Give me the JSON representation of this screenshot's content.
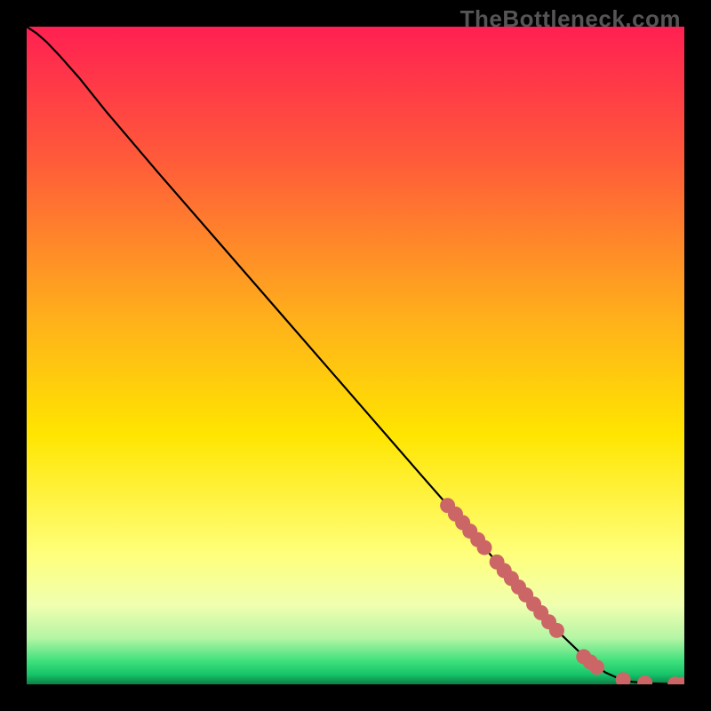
{
  "watermark": "TheBottleneck.com",
  "chart_data": {
    "type": "line",
    "title": "",
    "xlabel": "",
    "ylabel": "",
    "xlim": [
      0,
      100
    ],
    "ylim": [
      0,
      100
    ],
    "gradient_stops": [
      {
        "offset": 0.0,
        "color": "#FF2052"
      },
      {
        "offset": 0.2,
        "color": "#FF5A3A"
      },
      {
        "offset": 0.45,
        "color": "#FFB21A"
      },
      {
        "offset": 0.62,
        "color": "#FFE500"
      },
      {
        "offset": 0.8,
        "color": "#FFFF7A"
      },
      {
        "offset": 0.88,
        "color": "#F0FFB0"
      },
      {
        "offset": 0.93,
        "color": "#B4F5A4"
      },
      {
        "offset": 0.965,
        "color": "#3EE07C"
      },
      {
        "offset": 0.985,
        "color": "#17C46A"
      },
      {
        "offset": 1.0,
        "color": "#0B7F45"
      }
    ],
    "curve": [
      {
        "x": 0,
        "y": 100
      },
      {
        "x": 1.5,
        "y": 99.0
      },
      {
        "x": 3.0,
        "y": 97.7
      },
      {
        "x": 5.0,
        "y": 95.6
      },
      {
        "x": 8.0,
        "y": 92.2
      },
      {
        "x": 12.0,
        "y": 87.2
      },
      {
        "x": 20.0,
        "y": 77.8
      },
      {
        "x": 30.0,
        "y": 66.3
      },
      {
        "x": 40.0,
        "y": 54.8
      },
      {
        "x": 50.0,
        "y": 43.3
      },
      {
        "x": 60.0,
        "y": 31.8
      },
      {
        "x": 65.0,
        "y": 26.1
      },
      {
        "x": 70.0,
        "y": 20.3
      },
      {
        "x": 75.0,
        "y": 14.6
      },
      {
        "x": 80.0,
        "y": 8.8
      },
      {
        "x": 85.0,
        "y": 4.0
      },
      {
        "x": 88.0,
        "y": 1.8
      },
      {
        "x": 90.0,
        "y": 0.9
      },
      {
        "x": 92.0,
        "y": 0.4
      },
      {
        "x": 95.0,
        "y": 0.15
      },
      {
        "x": 98.0,
        "y": 0.05
      },
      {
        "x": 100.0,
        "y": 0.0
      }
    ],
    "markers": [
      {
        "x": 64.0,
        "y": 27.2
      },
      {
        "x": 65.2,
        "y": 25.9
      },
      {
        "x": 66.3,
        "y": 24.6
      },
      {
        "x": 67.4,
        "y": 23.3
      },
      {
        "x": 68.6,
        "y": 22.0
      },
      {
        "x": 69.6,
        "y": 20.8
      },
      {
        "x": 71.5,
        "y": 18.6
      },
      {
        "x": 72.6,
        "y": 17.3
      },
      {
        "x": 73.7,
        "y": 16.1
      },
      {
        "x": 74.8,
        "y": 14.8
      },
      {
        "x": 75.9,
        "y": 13.6
      },
      {
        "x": 77.1,
        "y": 12.2
      },
      {
        "x": 78.2,
        "y": 10.9
      },
      {
        "x": 79.4,
        "y": 9.5
      },
      {
        "x": 80.6,
        "y": 8.2
      },
      {
        "x": 84.7,
        "y": 4.2
      },
      {
        "x": 85.7,
        "y": 3.4
      },
      {
        "x": 86.7,
        "y": 2.6
      },
      {
        "x": 90.7,
        "y": 0.7
      },
      {
        "x": 94.0,
        "y": 0.2
      },
      {
        "x": 98.6,
        "y": 0.03
      },
      {
        "x": 99.6,
        "y": 0.0
      }
    ],
    "marker_style": {
      "r": 8.5,
      "fill": "#CC6666"
    }
  }
}
